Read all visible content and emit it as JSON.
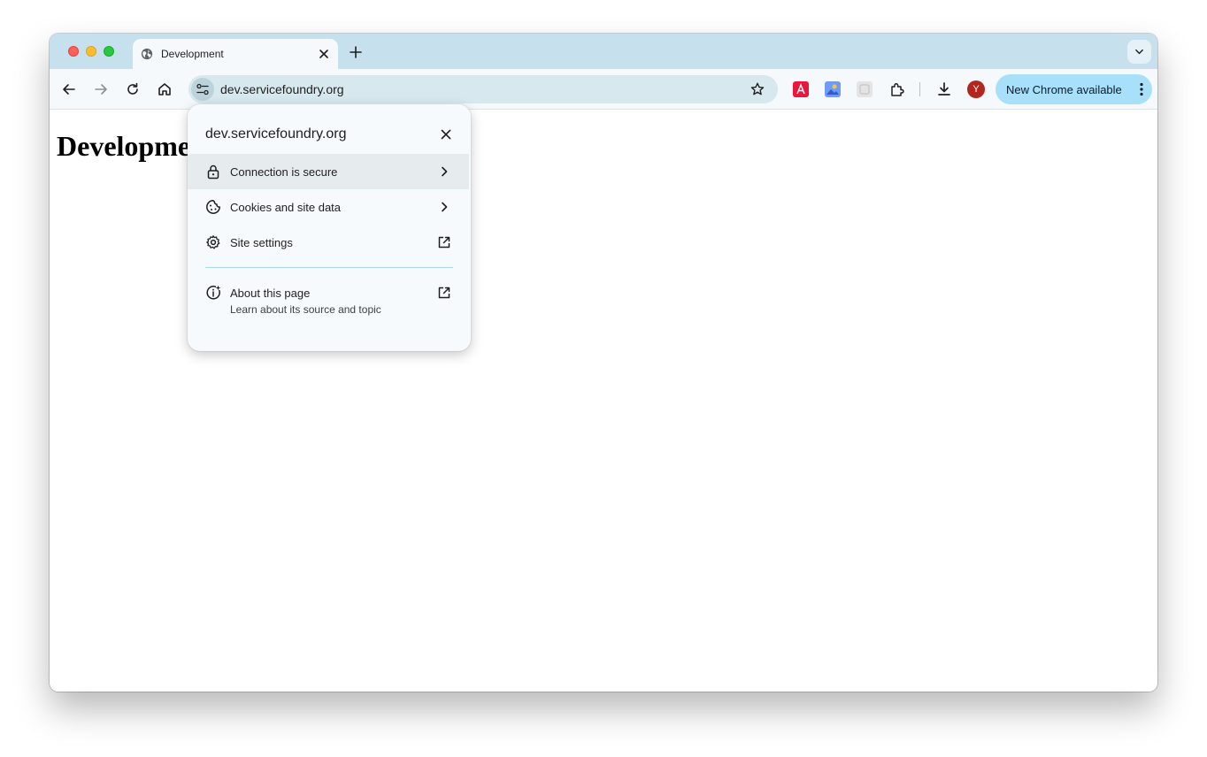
{
  "window": {
    "tab": {
      "title": "Development",
      "icon": "globe-icon"
    },
    "new_tab_icon": "plus-icon",
    "tab_search_icon": "chevron-down-icon"
  },
  "toolbar": {
    "url": "dev.servicefoundry.org",
    "update_label": "New Chrome available",
    "avatar_initial": "Y",
    "extensions": [
      {
        "name": "adobe-acrobat-extension",
        "color": "#e8173d"
      },
      {
        "name": "photo-extension",
        "color": "#6f9cf2"
      },
      {
        "name": "grey-extension",
        "color": "#d6d6d6"
      }
    ]
  },
  "page": {
    "heading": "Development"
  },
  "site_info_popup": {
    "title": "dev.servicefoundry.org",
    "items": [
      {
        "label": "Connection is secure",
        "icon": "lock-icon",
        "trailing": "chevron-right-icon"
      },
      {
        "label": "Cookies and site data",
        "icon": "cookie-icon",
        "trailing": "chevron-right-icon"
      },
      {
        "label": "Site settings",
        "icon": "gear-icon",
        "trailing": "external-link-icon"
      }
    ],
    "about": {
      "label": "About this page",
      "sublabel": "Learn about its source and topic",
      "icon": "info-sparkle-icon",
      "trailing": "external-link-icon"
    }
  },
  "colors": {
    "tabstrip": "#c7e0ed",
    "toolbar": "#f5f9fc",
    "omnibox": "#d7e8ee",
    "update_pill": "#a8e0fa",
    "avatar": "#b3261e"
  }
}
